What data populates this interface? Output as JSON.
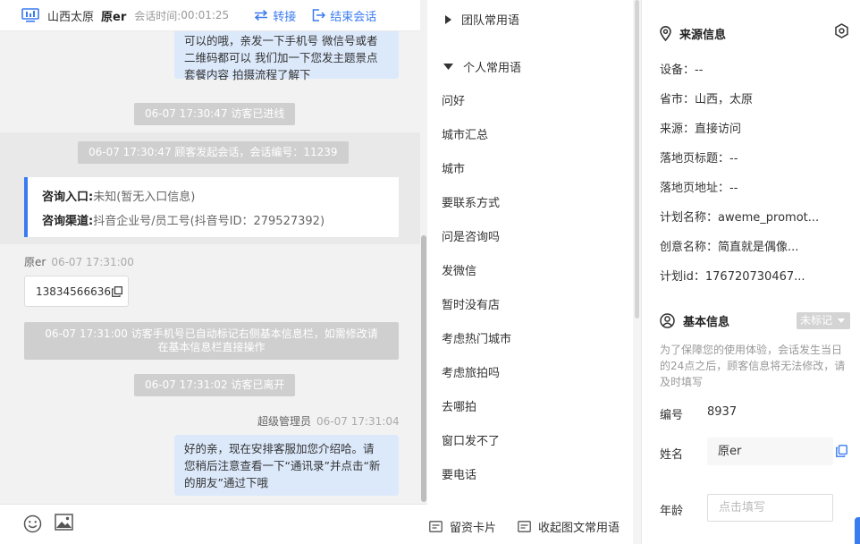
{
  "header": {
    "location": "山西太原",
    "visitor_name": "原er",
    "session_time_label": "会话时间:",
    "session_time": "00:01:25",
    "transfer_label": "转接",
    "end_session_label": "结束会话"
  },
  "messages": {
    "top_bubble": [
      "可以的哦，亲发一下手机号 微信号或者",
      "二维码都可以 我们加一下您发主题景点",
      "套餐内容 拍摄流程了解下"
    ],
    "sys_visitor_entered": "06-07 17:30:47 访客已进线",
    "sys_session_started": "06-07 17:30:47 顾客发起会话，会话编号：11239",
    "info_card": {
      "entry_label": "咨询入口:",
      "entry_value": "未知(暂无入口信息)",
      "channel_label": "咨询渠道:",
      "channel_value": "抖音企业号/员工号(抖音号ID：279527392)"
    },
    "visitor_sender": "原er",
    "visitor_time": "06-07 17:31:00",
    "phone": "13834566636",
    "sys_phone_marked": [
      "06-07 17:31:00 访客手机号已自动标记右侧基本信息栏，如需修改请",
      "在基本信息栏直接操作"
    ],
    "sys_visitor_left": "06-07 17:31:02 访客已离开",
    "admin_sender": "超级管理员",
    "admin_time": "06-07 17:31:04",
    "admin_bubble": [
      "好的亲，现在安排客服加您介绍哈。请",
      "您稍后注意查看一下“通讯录”并点击“新",
      "的朋友”通过下哦"
    ]
  },
  "phrases": {
    "team_group": "团队常用语",
    "personal_group": "个人常用语",
    "items": [
      "问好",
      "城市汇总",
      "城市",
      "要联系方式",
      "问是咨询吗",
      "发微信",
      "暂时没有店",
      "考虑热门城市",
      "考虑旅拍吗",
      "去哪拍",
      "窗口发不了",
      "要电话"
    ],
    "footer_card": "留资卡片",
    "footer_collapse": "收起图文常用语"
  },
  "source_info": {
    "title": "来源信息",
    "rows": [
      {
        "label": "设备：",
        "value": "--"
      },
      {
        "label": "省市：",
        "value": "山西，太原"
      },
      {
        "label": "来源：",
        "value": "直接访问"
      },
      {
        "label": "落地页标题：",
        "value": "--"
      },
      {
        "label": "落地页地址：",
        "value": "--"
      },
      {
        "label": "计划名称：",
        "value": "aweme_promot..."
      },
      {
        "label": "创意名称：",
        "value": "简直就是偶像..."
      },
      {
        "label": "计划id：",
        "value": "176720730467..."
      }
    ]
  },
  "basic_info": {
    "title": "基本信息",
    "status": "未标记",
    "notice": "为了保障您的使用体验，会话发生当日的24点之后，顾客信息将无法修改，请及时填写",
    "id_label": "编号",
    "id_value": "8937",
    "name_label": "姓名",
    "name_value": "原er",
    "age_label": "年龄",
    "age_placeholder": "点击填写"
  },
  "colors": {
    "accent": "#3a7bf0",
    "bubble": "#dce9fb",
    "system_pill": "#cfcfcf"
  }
}
